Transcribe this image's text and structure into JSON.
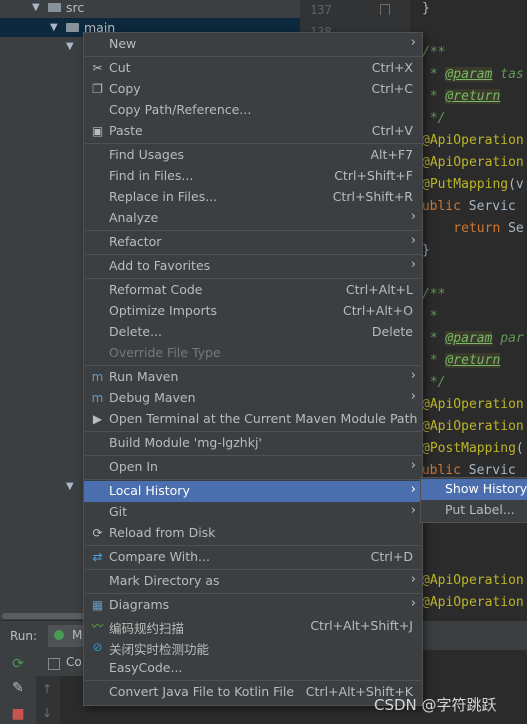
{
  "tree": {
    "items": [
      {
        "label": "src"
      },
      {
        "label": "main"
      }
    ]
  },
  "gutter": {
    "lines": [
      "137",
      "138"
    ]
  },
  "editor": {
    "lines": [
      {
        "parts": [
          {
            "t": "}",
            "c": "plain"
          }
        ]
      },
      {
        "parts": []
      },
      {
        "parts": [
          {
            "t": "/**",
            "c": "comment"
          }
        ]
      },
      {
        "parts": [
          {
            "t": " * ",
            "c": "comment"
          },
          {
            "t": "@param",
            "c": "tag"
          },
          {
            "t": " tas",
            "c": "comment"
          }
        ]
      },
      {
        "parts": [
          {
            "t": " * ",
            "c": "comment"
          },
          {
            "t": "@return",
            "c": "tag"
          }
        ]
      },
      {
        "parts": [
          {
            "t": " */",
            "c": "comment"
          }
        ]
      },
      {
        "parts": [
          {
            "t": "@ApiOperation",
            "c": "annot"
          }
        ]
      },
      {
        "parts": [
          {
            "t": "@ApiOperation",
            "c": "annot"
          }
        ]
      },
      {
        "parts": [
          {
            "t": "@PutMapping",
            "c": "annot"
          },
          {
            "t": "(v",
            "c": "plain"
          }
        ]
      },
      {
        "parts": [
          {
            "t": "public ",
            "c": "kw"
          },
          {
            "t": "Servic",
            "c": "plain"
          }
        ]
      },
      {
        "parts": [
          {
            "t": "    return ",
            "c": "kw"
          },
          {
            "t": "Se",
            "c": "plain"
          }
        ]
      },
      {
        "parts": [
          {
            "t": "}",
            "c": "plain"
          }
        ]
      },
      {
        "parts": []
      },
      {
        "parts": [
          {
            "t": "/**",
            "c": "comment"
          }
        ]
      },
      {
        "parts": [
          {
            "t": " *",
            "c": "comment"
          }
        ]
      },
      {
        "parts": [
          {
            "t": " * ",
            "c": "comment"
          },
          {
            "t": "@param",
            "c": "tag"
          },
          {
            "t": " par",
            "c": "comment"
          }
        ]
      },
      {
        "parts": [
          {
            "t": " * ",
            "c": "comment"
          },
          {
            "t": "@return",
            "c": "tag"
          }
        ]
      },
      {
        "parts": [
          {
            "t": " */",
            "c": "comment"
          }
        ]
      },
      {
        "parts": [
          {
            "t": "@ApiOperation",
            "c": "annot"
          }
        ]
      },
      {
        "parts": [
          {
            "t": "@ApiOperation",
            "c": "annot"
          }
        ]
      },
      {
        "parts": [
          {
            "t": "@PostMapping",
            "c": "annot"
          },
          {
            "t": "(",
            "c": "plain"
          }
        ]
      },
      {
        "parts": [
          {
            "t": "public ",
            "c": "kw"
          },
          {
            "t": "Servic",
            "c": "plain"
          }
        ]
      },
      {
        "parts": []
      },
      {
        "parts": []
      },
      {
        "parts": []
      },
      {
        "parts": []
      },
      {
        "parts": [
          {
            "t": "@ApiOperation",
            "c": "annot"
          }
        ]
      },
      {
        "parts": [
          {
            "t": "@ApiOperation",
            "c": "annot"
          }
        ]
      }
    ]
  },
  "run": {
    "label": "Run:",
    "tab": "M",
    "subtab": "Co"
  },
  "menu": {
    "items": [
      {
        "label": "New",
        "shortcut": "",
        "submenu": true,
        "icon": ""
      },
      {
        "sep": true
      },
      {
        "label": "Cut",
        "shortcut": "Ctrl+X",
        "icon": "scissors-icon"
      },
      {
        "label": "Copy",
        "shortcut": "Ctrl+C",
        "icon": "copy-icon"
      },
      {
        "label": "Copy Path/Reference...",
        "shortcut": "",
        "icon": ""
      },
      {
        "label": "Paste",
        "shortcut": "Ctrl+V",
        "icon": "paste-icon"
      },
      {
        "sep": true
      },
      {
        "label": "Find Usages",
        "shortcut": "Alt+F7",
        "icon": ""
      },
      {
        "label": "Find in Files...",
        "shortcut": "Ctrl+Shift+F",
        "icon": ""
      },
      {
        "label": "Replace in Files...",
        "shortcut": "Ctrl+Shift+R",
        "icon": ""
      },
      {
        "label": "Analyze",
        "shortcut": "",
        "submenu": true,
        "icon": ""
      },
      {
        "sep": true
      },
      {
        "label": "Refactor",
        "shortcut": "",
        "submenu": true,
        "icon": ""
      },
      {
        "sep": true
      },
      {
        "label": "Add to Favorites",
        "shortcut": "",
        "submenu": true,
        "icon": ""
      },
      {
        "sep": true
      },
      {
        "label": "Reformat Code",
        "shortcut": "Ctrl+Alt+L",
        "icon": ""
      },
      {
        "label": "Optimize Imports",
        "shortcut": "Ctrl+Alt+O",
        "icon": ""
      },
      {
        "label": "Delete...",
        "shortcut": "Delete",
        "icon": ""
      },
      {
        "label": "Override File Type",
        "shortcut": "",
        "icon": "",
        "disabled": true
      },
      {
        "sep": true
      },
      {
        "label": "Run Maven",
        "shortcut": "",
        "submenu": true,
        "icon": "maven-icon"
      },
      {
        "label": "Debug Maven",
        "shortcut": "",
        "submenu": true,
        "icon": "maven-icon"
      },
      {
        "label": "Open Terminal at the Current Maven Module Path",
        "shortcut": "",
        "icon": "terminal-icon"
      },
      {
        "sep": true
      },
      {
        "label": "Build Module 'mg-lgzhkj'",
        "shortcut": "",
        "icon": ""
      },
      {
        "sep": true
      },
      {
        "label": "Open In",
        "shortcut": "",
        "submenu": true,
        "icon": ""
      },
      {
        "sep": true
      },
      {
        "label": "Local History",
        "shortcut": "",
        "submenu": true,
        "icon": "",
        "highlighted": true
      },
      {
        "label": "Git",
        "shortcut": "",
        "submenu": true,
        "icon": ""
      },
      {
        "label": "Reload from Disk",
        "shortcut": "",
        "icon": "reload-icon"
      },
      {
        "sep": true
      },
      {
        "label": "Compare With...",
        "shortcut": "Ctrl+D",
        "icon": "compare-icon"
      },
      {
        "sep": true
      },
      {
        "label": "Mark Directory as",
        "shortcut": "",
        "submenu": true,
        "icon": ""
      },
      {
        "sep": true
      },
      {
        "label": "Diagrams",
        "shortcut": "",
        "submenu": true,
        "icon": "diagram-icon"
      },
      {
        "label": "编码规约扫描",
        "shortcut": "Ctrl+Alt+Shift+J",
        "icon": "scan-icon"
      },
      {
        "label": "关闭实时检测功能",
        "shortcut": "",
        "icon": "disable-icon"
      },
      {
        "label": "EasyCode...",
        "shortcut": "",
        "icon": ""
      },
      {
        "sep": true
      },
      {
        "label": "Convert Java File to Kotlin File",
        "shortcut": "Ctrl+Alt+Shift+K",
        "icon": ""
      }
    ]
  },
  "submenu": {
    "items": [
      {
        "label": "Show History",
        "highlighted": true
      },
      {
        "label": "Put Label..."
      }
    ]
  },
  "watermark": "CSDN @字符跳跃"
}
